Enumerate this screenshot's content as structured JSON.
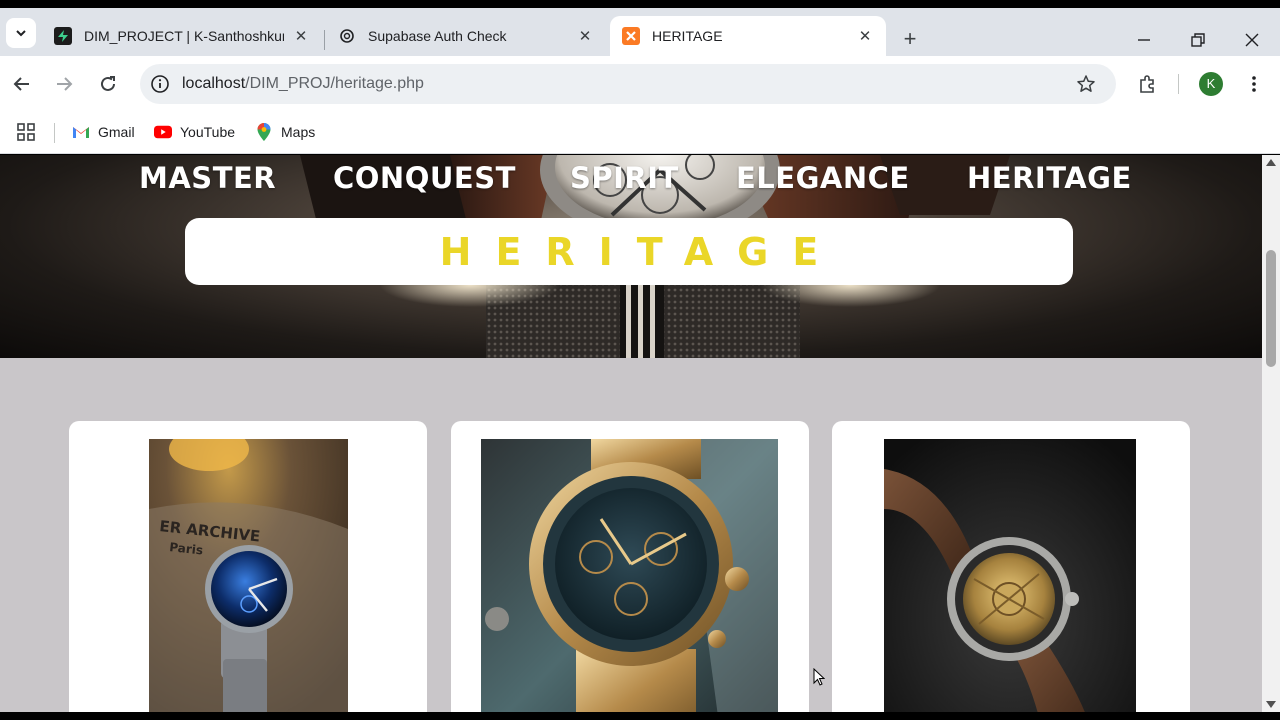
{
  "browser": {
    "tabs": [
      {
        "title": "DIM_PROJECT | K-Santhoshkum",
        "favicon": "supabase-icon",
        "active": false
      },
      {
        "title": "Supabase Auth Check",
        "favicon": "chatgpt-icon",
        "active": false
      },
      {
        "title": "HERITAGE",
        "favicon": "xampp-icon",
        "active": true
      }
    ],
    "url_host": "localhost",
    "url_path": "/DIM_PROJ/heritage.php",
    "profile_initial": "K",
    "bookmarks": [
      {
        "label": "Gmail",
        "icon": "gmail-icon"
      },
      {
        "label": "YouTube",
        "icon": "youtube-icon"
      },
      {
        "label": "Maps",
        "icon": "maps-icon"
      }
    ]
  },
  "site": {
    "nav": [
      "MASTER",
      "CONQUEST",
      "SPIRIT",
      "ELEGANCE",
      "HERITAGE"
    ],
    "banner_title": "HERITAGE",
    "accent_color": "#ead628",
    "products": [
      {
        "image": "watch-blue-dial-photo"
      },
      {
        "image": "watch-gold-chronograph-photo"
      },
      {
        "image": "watch-skeleton-leather-photo"
      }
    ]
  }
}
